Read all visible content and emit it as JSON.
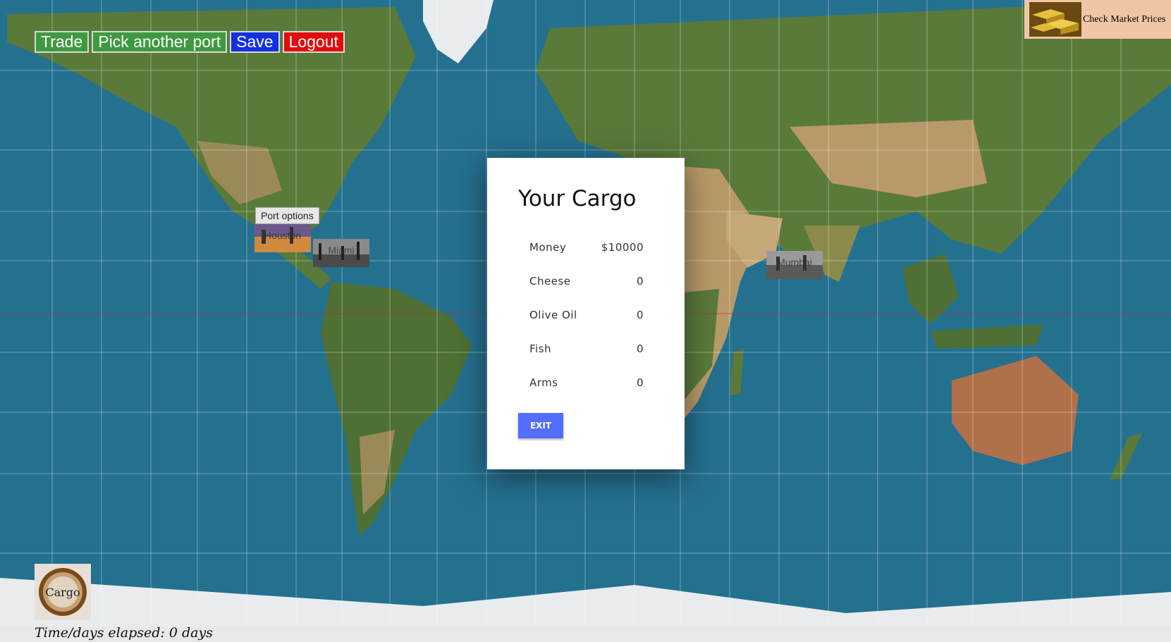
{
  "toolbar": {
    "trade": "Trade",
    "pick_port": "Pick another port",
    "save": "Save",
    "logout": "Logout"
  },
  "market": {
    "label": "Check Market Prices",
    "icon": "gold-bars-icon"
  },
  "ports": [
    {
      "name": "Houston"
    },
    {
      "name": "Miami"
    },
    {
      "name": "Mumbai"
    }
  ],
  "tooltip": "Port options",
  "modal": {
    "title": "Your Cargo",
    "items": [
      {
        "label": "Money",
        "value": "$10000"
      },
      {
        "label": "Cheese",
        "value": "0"
      },
      {
        "label": "Olive Oil",
        "value": "0"
      },
      {
        "label": "Fish",
        "value": "0"
      },
      {
        "label": "Arms",
        "value": "0"
      }
    ],
    "exit": "EXIT"
  },
  "cargo_button": {
    "label": "Cargo",
    "icon": "compass-icon"
  },
  "status": "Time/days elapsed: 0 days",
  "colors": {
    "ocean": "#24708f",
    "land": "#5a7a3a",
    "desert": "#b89a6a",
    "ice": "#e8ecef",
    "exit_button": "#536dfe",
    "trade_button": "#3f9a3f",
    "save_button": "#1431e0",
    "logout_button": "#e20c0c",
    "market_bg": "#f1c6a6"
  }
}
